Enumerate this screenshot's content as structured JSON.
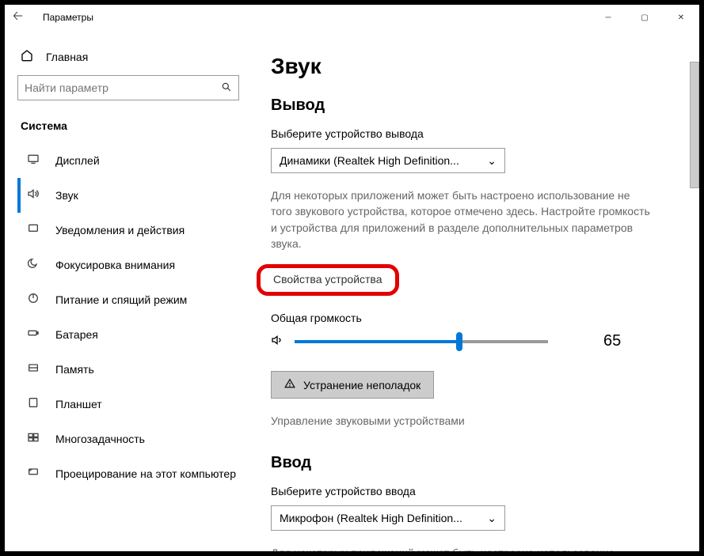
{
  "window": {
    "title": "Параметры"
  },
  "sidebar": {
    "home": "Главная",
    "search_placeholder": "Найти параметр",
    "section": "Система",
    "items": [
      {
        "label": "Дисплей"
      },
      {
        "label": "Звук",
        "active": true
      },
      {
        "label": "Уведомления и действия"
      },
      {
        "label": "Фокусировка внимания"
      },
      {
        "label": "Питание и спящий режим"
      },
      {
        "label": "Батарея"
      },
      {
        "label": "Память"
      },
      {
        "label": "Планшет"
      },
      {
        "label": "Многозадачность"
      },
      {
        "label": "Проецирование на этот компьютер"
      }
    ]
  },
  "main": {
    "title": "Звук",
    "output": {
      "heading": "Вывод",
      "label": "Выберите устройство вывода",
      "device": "Динамики (Realtek High Definition...",
      "help": "Для некоторых приложений может быть настроено использование не того звукового устройства, которое отмечено здесь. Настройте громкость и устройства для приложений в разделе дополнительных параметров звука.",
      "device_props": "Свойства устройства",
      "volume_label": "Общая громкость",
      "volume_value": "65",
      "troubleshoot": "Устранение неполадок",
      "manage": "Управление звуковыми устройствами"
    },
    "input": {
      "heading": "Ввод",
      "label": "Выберите устройство ввода",
      "device": "Микрофон (Realtek High Definition...",
      "help": "Для некоторых приложений может быть настроено использование"
    }
  }
}
